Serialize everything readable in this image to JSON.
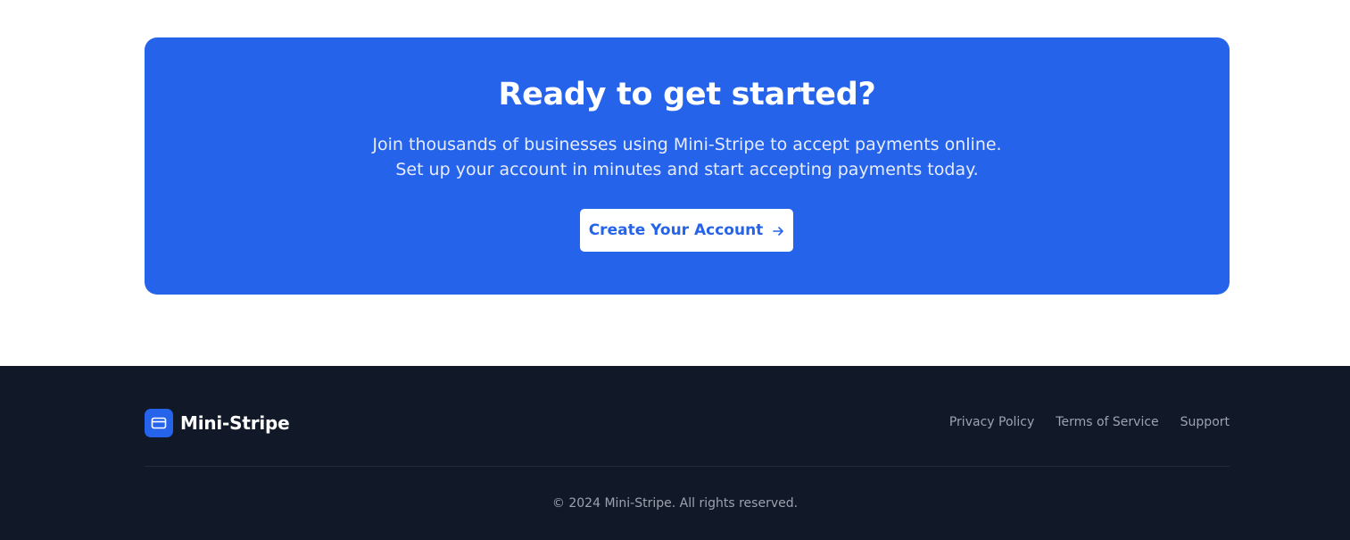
{
  "cta": {
    "title": "Ready to get started?",
    "subtitle_line1": "Join thousands of businesses using Mini-Stripe to accept payments online.",
    "subtitle_line2": "Set up your account in minutes and start accepting payments today.",
    "button_label": "Create Your Account",
    "button_icon": "arrow-right-icon"
  },
  "footer": {
    "brand": "Mini-Stripe",
    "logo_icon": "credit-card-icon",
    "links": [
      "Privacy Policy",
      "Terms of Service",
      "Support"
    ],
    "copyright": "© 2024 Mini-Stripe. All rights reserved."
  },
  "colors": {
    "accent": "#2563eb",
    "footer_bg": "#111827",
    "footer_text": "#9ca3af"
  }
}
